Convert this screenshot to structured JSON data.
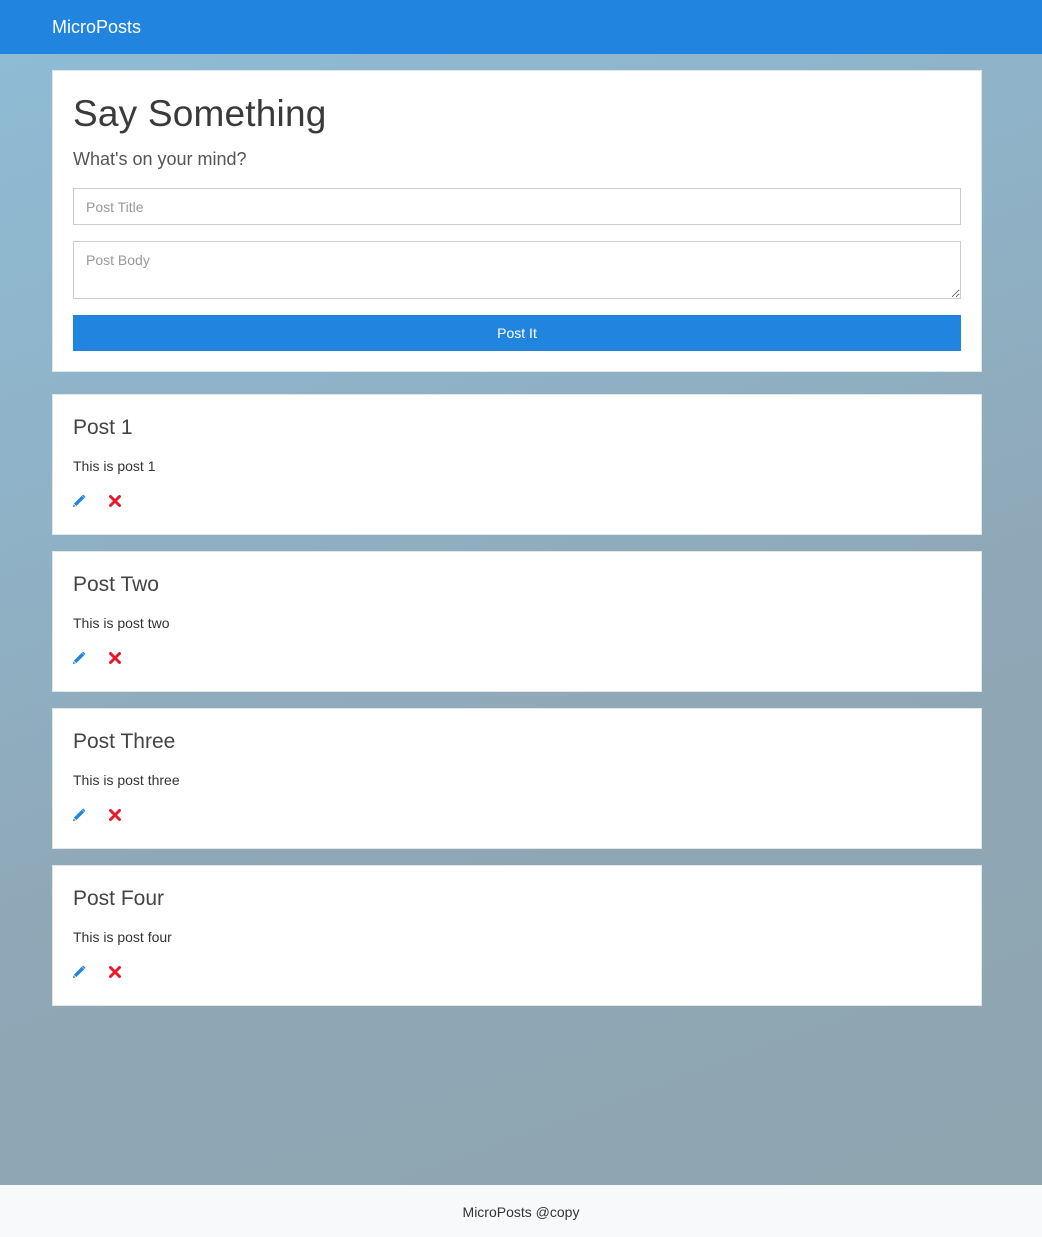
{
  "navbar": {
    "brand": "MicroPosts"
  },
  "form": {
    "heading": "Say Something",
    "subheading": "What's on your mind?",
    "title_placeholder": "Post Title",
    "body_placeholder": "Post Body",
    "submit_label": "Post It"
  },
  "posts": [
    {
      "title": "Post 1",
      "body": "This is post 1"
    },
    {
      "title": "Post Two",
      "body": "This is post two"
    },
    {
      "title": "Post Three",
      "body": "This is post three"
    },
    {
      "title": "Post Four",
      "body": "This is post four"
    }
  ],
  "icons": {
    "edit": "pencil-icon",
    "delete": "close-icon"
  },
  "colors": {
    "primary": "#2185e0",
    "danger": "#e8192c"
  },
  "footer": {
    "text": "MicroPosts @copy"
  }
}
